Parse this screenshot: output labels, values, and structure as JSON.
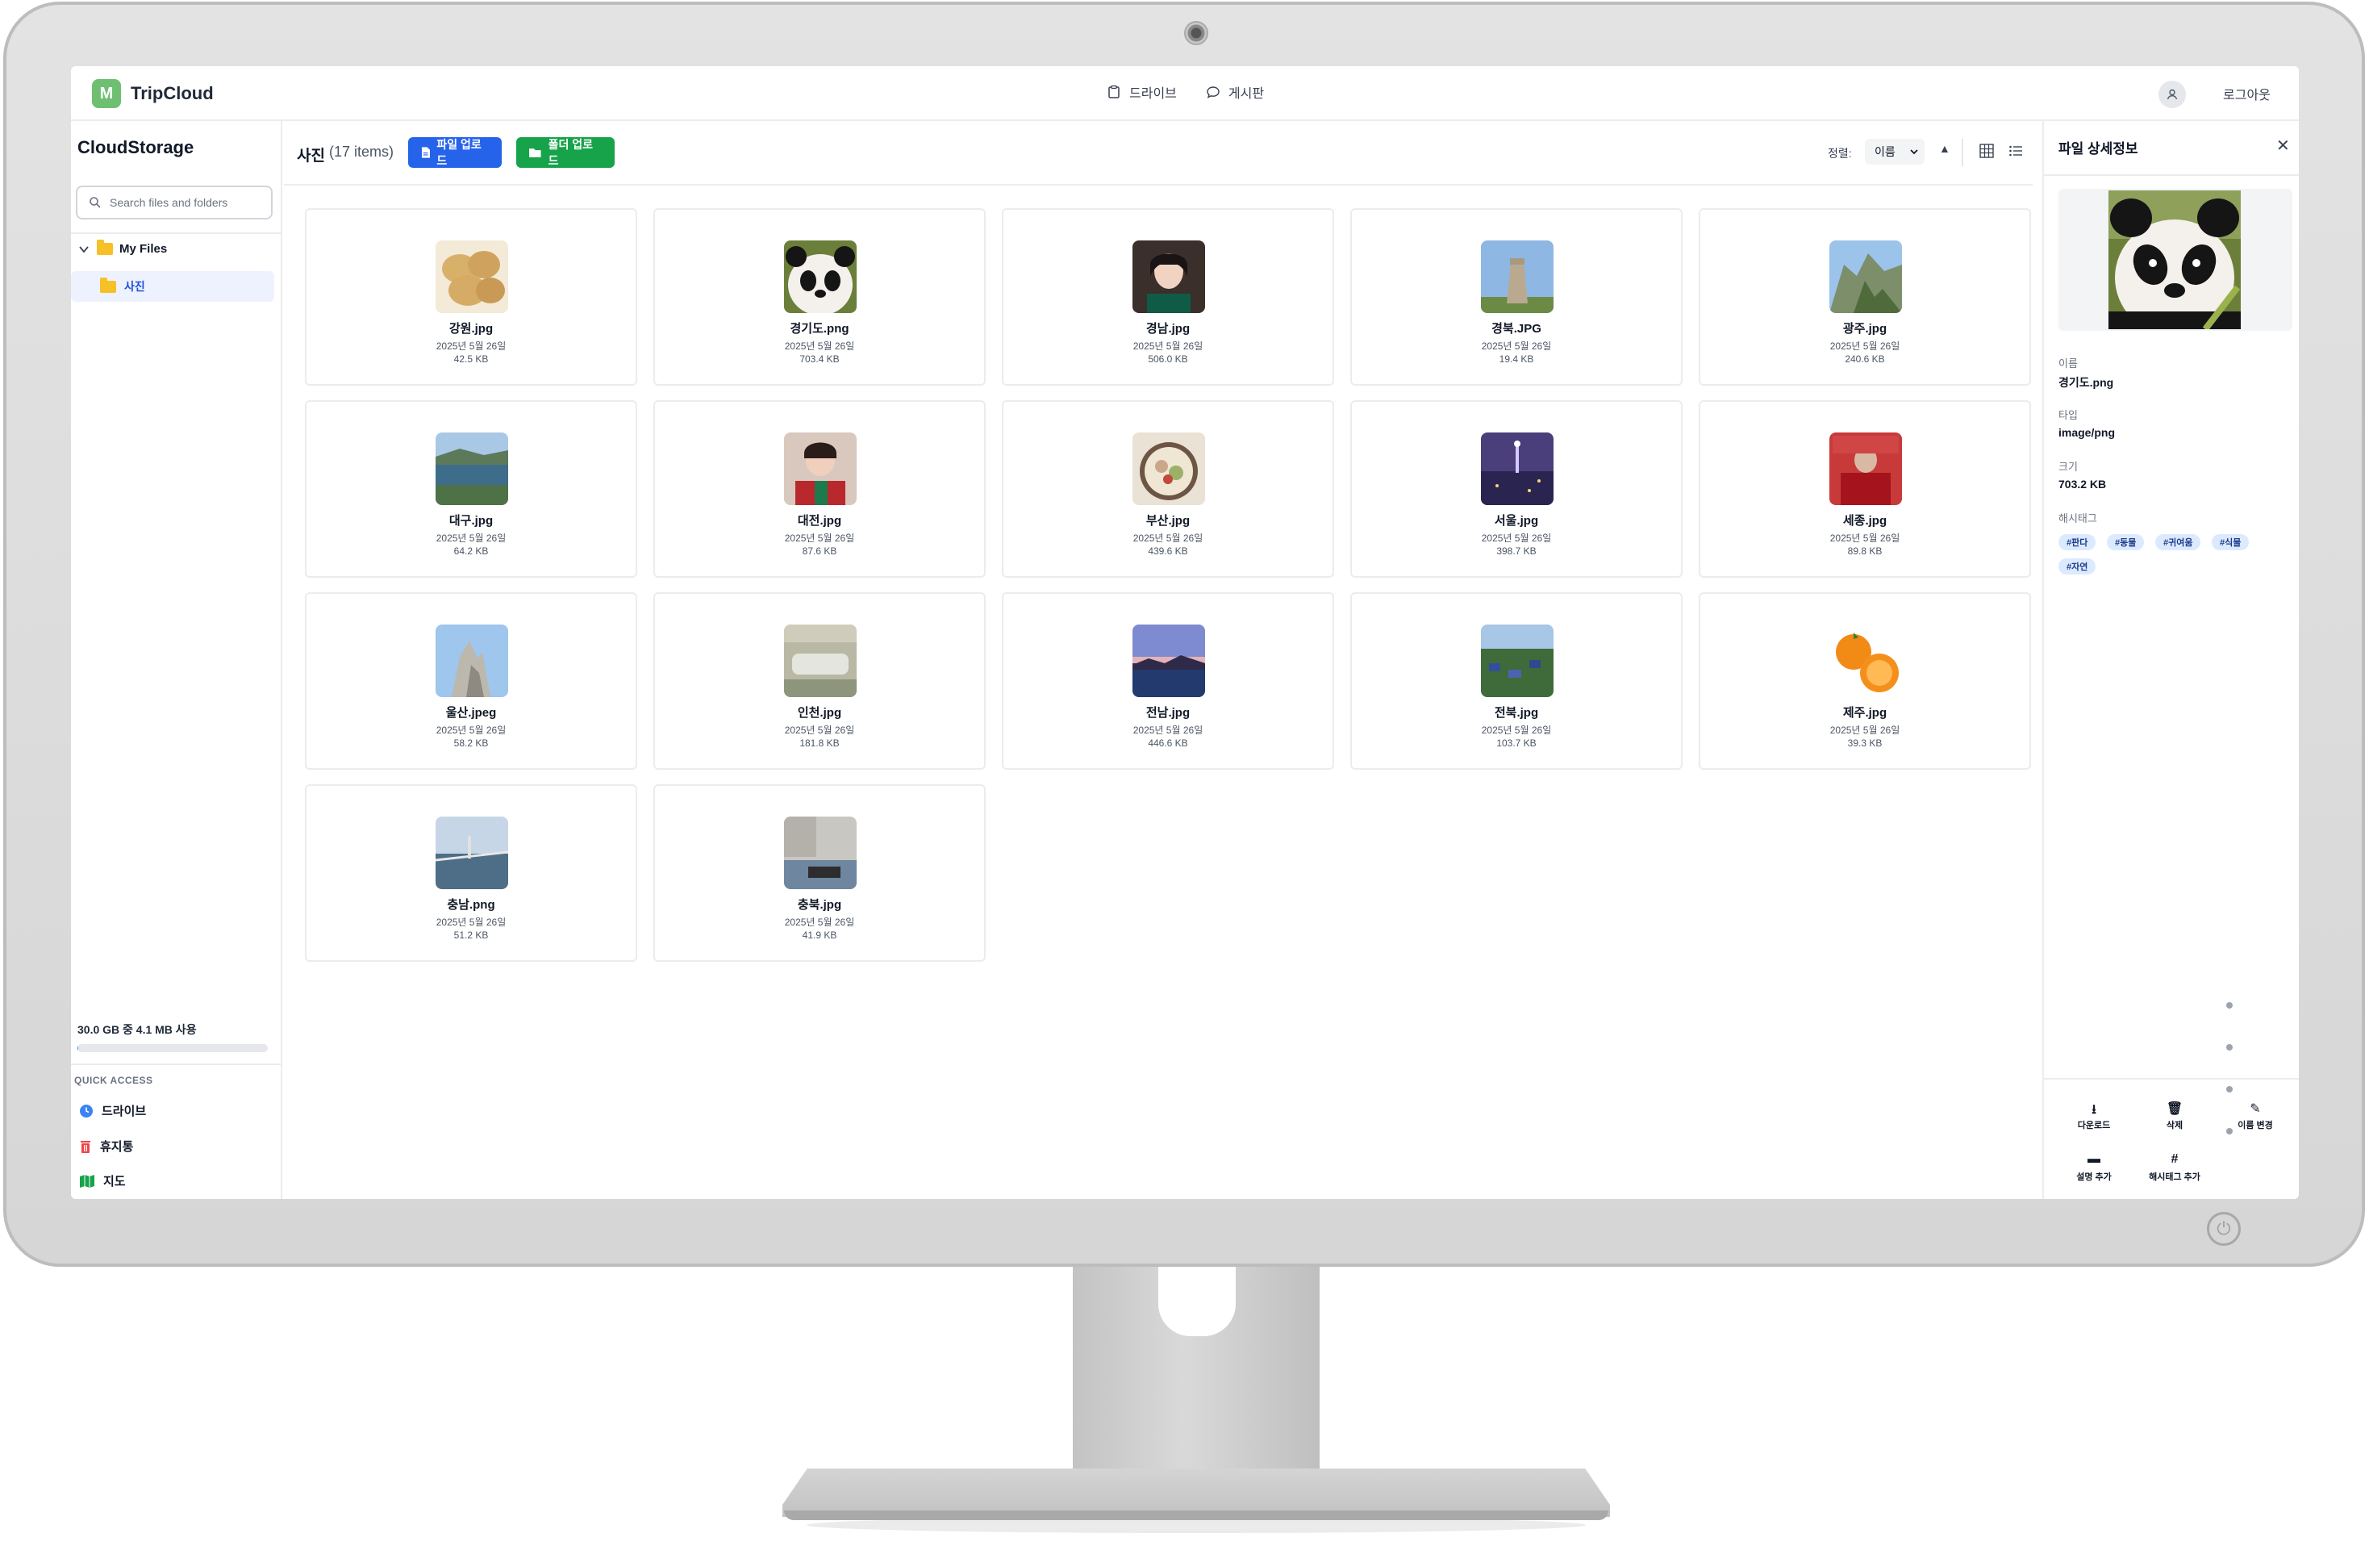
{
  "app": {
    "brand_initial": "M",
    "brand_name": "TripCloud"
  },
  "topnav": {
    "links": [
      {
        "label": "드라이브",
        "icon": "clipboard-icon"
      },
      {
        "label": "게시판",
        "icon": "chat-icon"
      }
    ],
    "logout_label": "로그아웃"
  },
  "sidebar": {
    "title": "CloudStorage",
    "search_placeholder": "Search files and folders",
    "tree_root": "My Files",
    "tree_child": "사진",
    "storage_text": "30.0 GB 중 4.1 MB 사용",
    "storage_fraction": 0.0002,
    "quick_access_label": "QUICK ACCESS",
    "quick_access": [
      {
        "label": "드라이브",
        "icon": "clock-icon",
        "color": "#3b82f6"
      },
      {
        "label": "휴지통",
        "icon": "trash-icon",
        "color": "#ef4444"
      },
      {
        "label": "지도",
        "icon": "map-icon",
        "color": "#16a34a"
      }
    ]
  },
  "main": {
    "folder_title": "사진",
    "item_count": "(17 items)",
    "upload_file_label": "파일 업로드",
    "upload_folder_label": "폴더 업로드",
    "sort_label": "정렬:",
    "sort_value": "이름",
    "files": [
      {
        "name": "강원.jpg",
        "date": "2025년 5월 26일",
        "size": "42.5 KB",
        "thumb": "potato"
      },
      {
        "name": "경기도.png",
        "date": "2025년 5월 26일",
        "size": "703.4 KB",
        "thumb": "panda"
      },
      {
        "name": "경남.jpg",
        "date": "2025년 5월 26일",
        "size": "506.0 KB",
        "thumb": "person"
      },
      {
        "name": "경북.JPG",
        "date": "2025년 5월 26일",
        "size": "19.4 KB",
        "thumb": "tower"
      },
      {
        "name": "광주.jpg",
        "date": "2025년 5월 26일",
        "size": "240.6 KB",
        "thumb": "mountain"
      },
      {
        "name": "대구.jpg",
        "date": "2025년 5월 26일",
        "size": "64.2 KB",
        "thumb": "river"
      },
      {
        "name": "대전.jpg",
        "date": "2025년 5월 26일",
        "size": "87.6 KB",
        "thumb": "fan"
      },
      {
        "name": "부산.jpg",
        "date": "2025년 5월 26일",
        "size": "439.6 KB",
        "thumb": "food"
      },
      {
        "name": "서울.jpg",
        "date": "2025년 5월 26일",
        "size": "398.7 KB",
        "thumb": "night"
      },
      {
        "name": "세종.jpg",
        "date": "2025년 5월 26일",
        "size": "89.8 KB",
        "thumb": "red"
      },
      {
        "name": "울산.jpeg",
        "date": "2025년 5월 26일",
        "size": "58.2 KB",
        "thumb": "sculpture"
      },
      {
        "name": "인천.jpg",
        "date": "2025년 5월 26일",
        "size": "181.8 KB",
        "thumb": "aerial"
      },
      {
        "name": "전남.jpg",
        "date": "2025년 5월 26일",
        "size": "446.6 KB",
        "thumb": "sunset"
      },
      {
        "name": "전북.jpg",
        "date": "2025년 5월 26일",
        "size": "103.7 KB",
        "thumb": "village"
      },
      {
        "name": "제주.jpg",
        "date": "2025년 5월 26일",
        "size": "39.3 KB",
        "thumb": "orange"
      },
      {
        "name": "충남.png",
        "date": "2025년 5월 26일",
        "size": "51.2 KB",
        "thumb": "bridge"
      },
      {
        "name": "충북.jpg",
        "date": "2025년 5월 26일",
        "size": "41.9 KB",
        "thumb": "desk"
      }
    ]
  },
  "panel": {
    "title": "파일 상세정보",
    "name_label": "이름",
    "name_value": "경기도.png",
    "type_label": "타입",
    "type_value": "image/png",
    "size_label": "크기",
    "size_value": "703.2 KB",
    "tags_label": "해시태그",
    "tags": [
      "#판다",
      "#동물",
      "#귀여움",
      "#식물",
      "#자연"
    ],
    "actions": [
      {
        "label": "다운로드",
        "icon": "download-icon"
      },
      {
        "label": "삭제",
        "icon": "trash-icon"
      },
      {
        "label": "이름 변경",
        "icon": "pencil-icon"
      },
      {
        "label": "설명 추가",
        "icon": "comment-icon"
      },
      {
        "label": "해시태그 추가",
        "icon": "hash-icon"
      }
    ]
  }
}
